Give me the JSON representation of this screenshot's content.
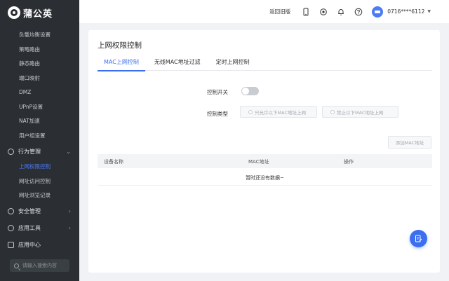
{
  "brand": {
    "name": "蒲公英"
  },
  "sidebar": {
    "items_top": [
      "负载均衡设置",
      "策略路由",
      "静态路由",
      "端口映射",
      "DMZ",
      "UPnP设置",
      "NAT加速",
      "用户组设置"
    ],
    "behavior_group": {
      "label": "行为管理",
      "items": [
        "上网权限控制",
        "网址访问控制",
        "网址浏览记录"
      ]
    },
    "security_group": {
      "label": "安全管理"
    },
    "tools_group": {
      "label": "应用工具"
    },
    "center_group": {
      "label": "应用中心"
    },
    "search_placeholder": "请输入搜索内容"
  },
  "topbar": {
    "return_old": "返回旧版",
    "user": "0716****6112"
  },
  "main": {
    "title": "上网权限控制",
    "tabs": [
      "MAC上网控制",
      "无线MAC地址过滤",
      "定时上网控制"
    ],
    "control_switch_label": "控制开关",
    "control_switch_on": false,
    "control_type_label": "控制类型",
    "control_type_options": [
      "只允许以下MAC地址上网",
      "禁止以下MAC地址上网"
    ],
    "add_mac_button": "添加MAC地址",
    "table_headers": [
      "设备名称",
      "MAC地址",
      "操作"
    ],
    "empty_text": "暂时还没有数据~"
  },
  "colors": {
    "accent": "#3c6ef0",
    "sidebar_bg": "#2b2f33"
  }
}
